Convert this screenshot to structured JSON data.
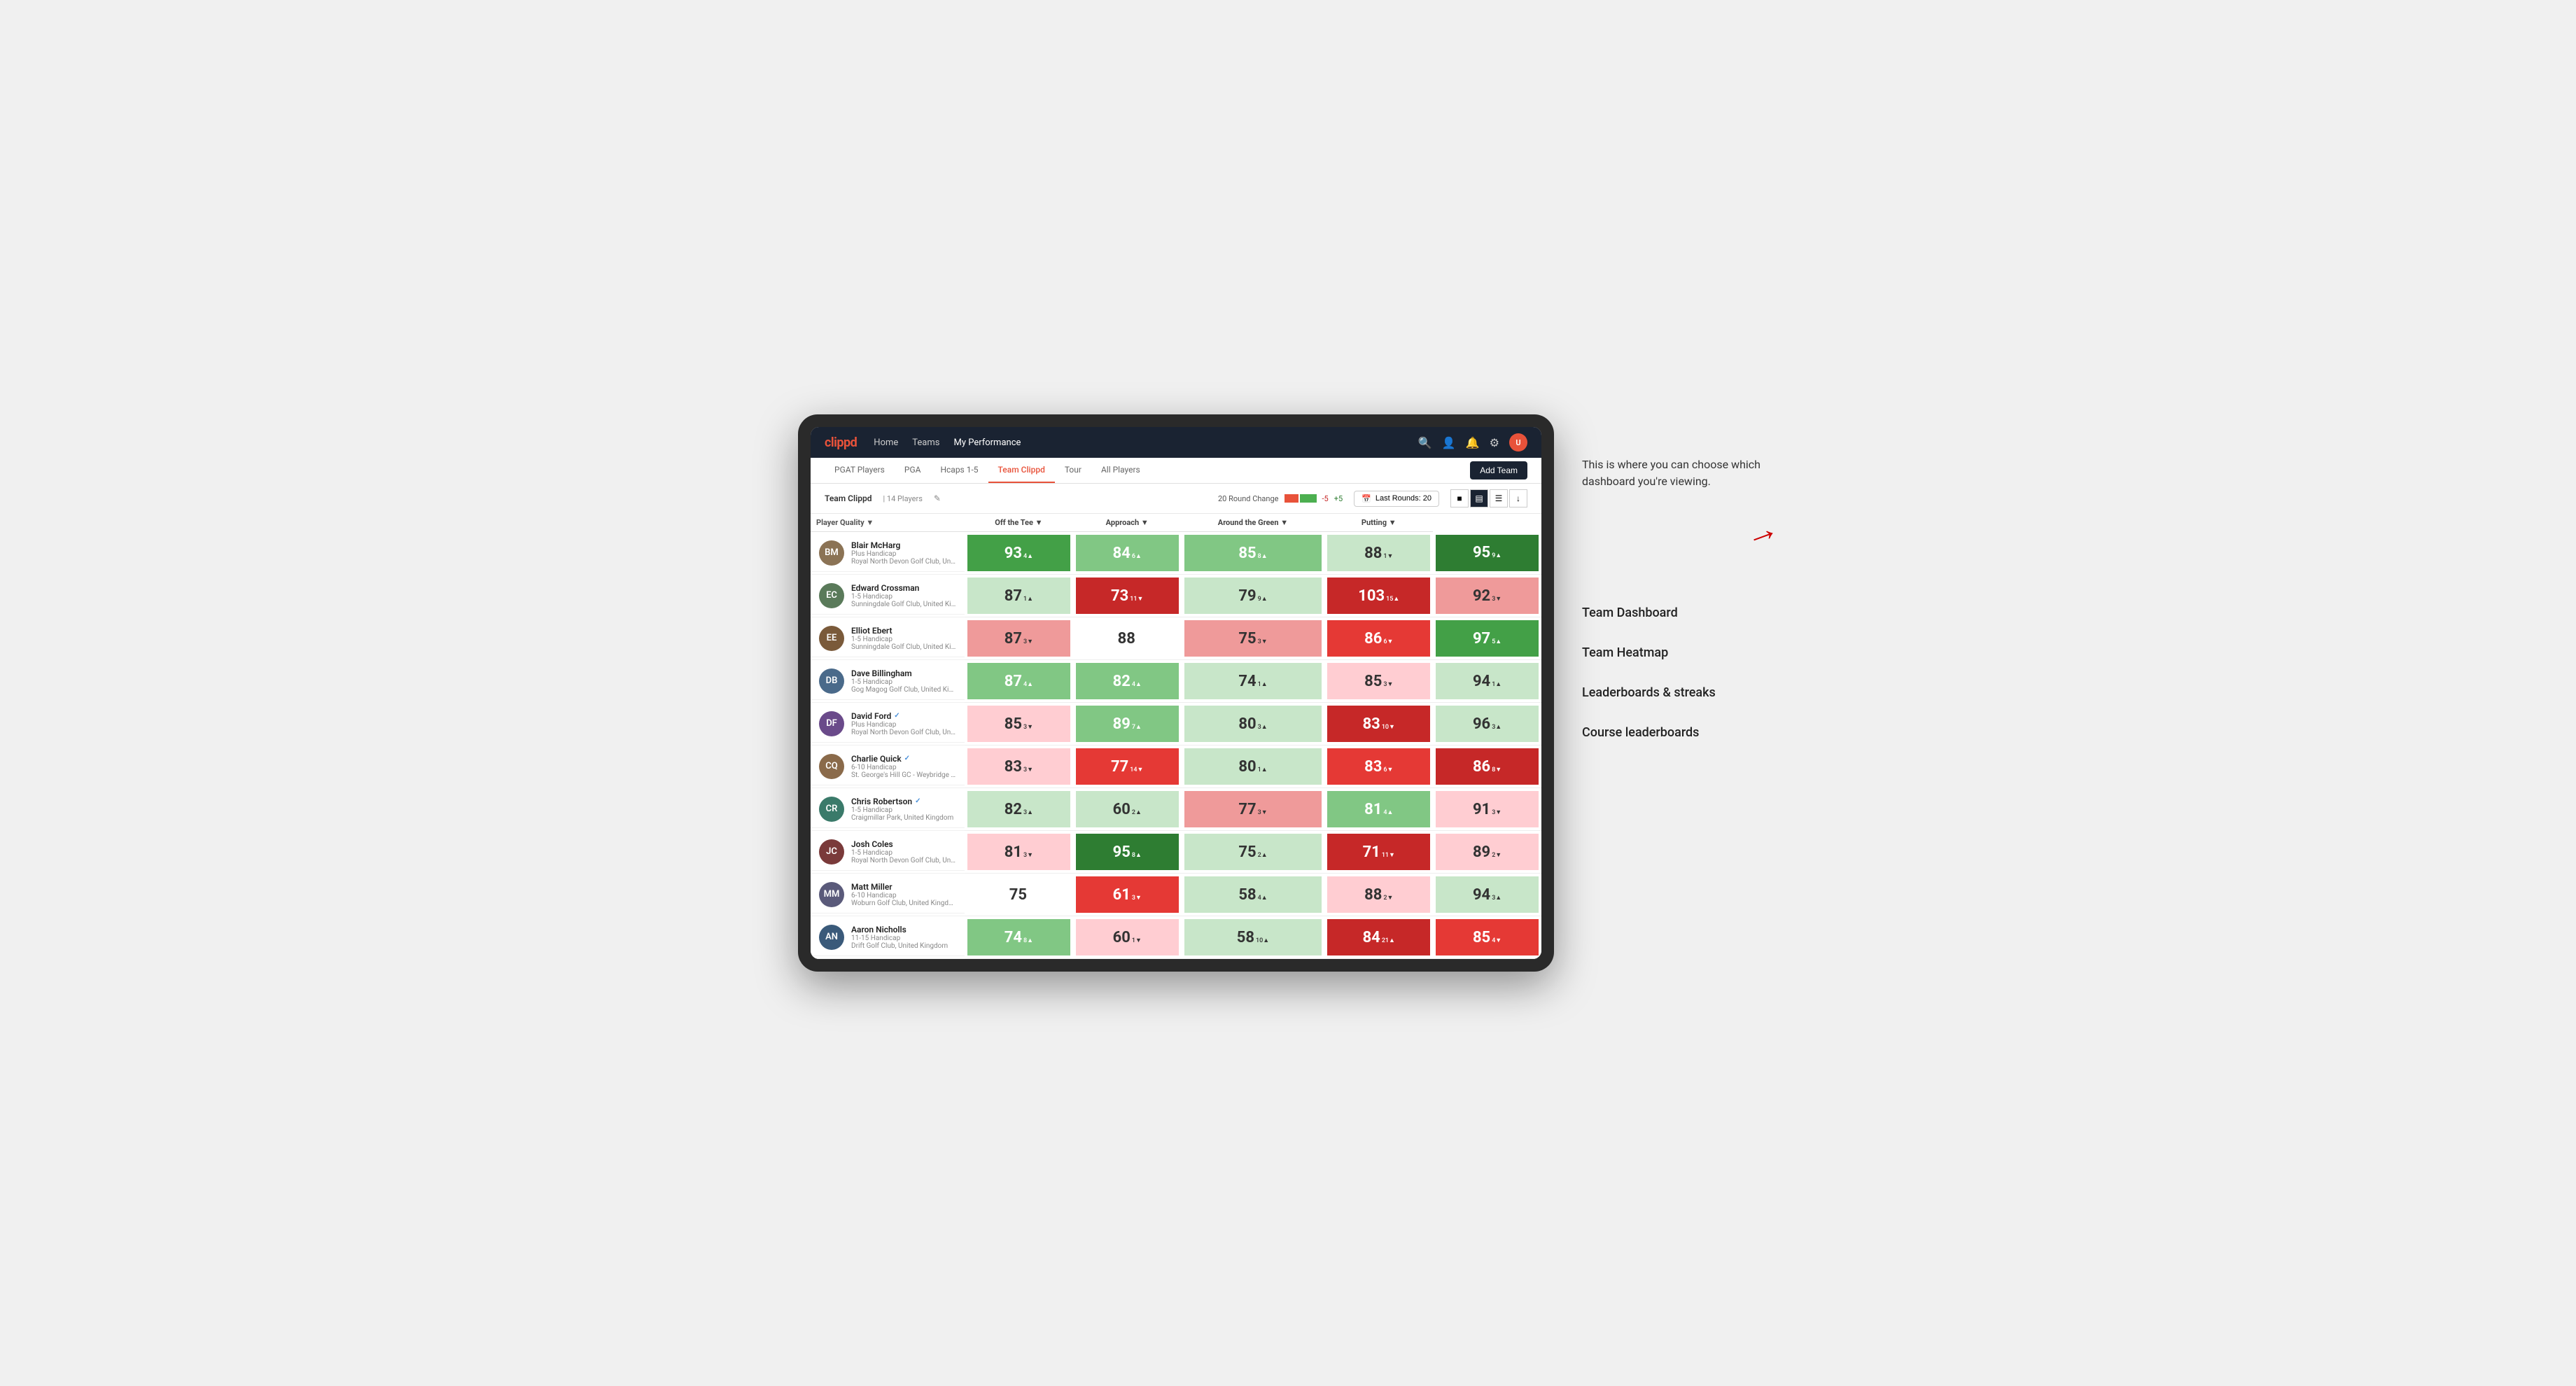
{
  "annotation": {
    "intro_text": "This is where you can choose which dashboard you're viewing.",
    "menu_items": [
      "Team Dashboard",
      "Team Heatmap",
      "Leaderboards & streaks",
      "Course leaderboards"
    ]
  },
  "app": {
    "logo": "clippd",
    "nav_links": [
      "Home",
      "Teams",
      "My Performance"
    ],
    "tabs": [
      "PGAT Players",
      "PGA",
      "Hcaps 1-5",
      "Team Clippd",
      "Tour",
      "All Players"
    ],
    "active_tab": "Team Clippd",
    "add_team_label": "Add Team"
  },
  "team_bar": {
    "name": "Team Clippd",
    "separator": "|",
    "count": "14 Players",
    "round_change_label": "20 Round Change",
    "change_neg": "-5",
    "change_pos": "+5",
    "last_rounds_label": "Last Rounds:",
    "last_rounds_value": "20"
  },
  "table": {
    "col_headers": {
      "player_quality": "Player Quality",
      "off_the_tee": "Off the Tee",
      "approach": "Approach",
      "around_green": "Around the Green",
      "putting": "Putting"
    },
    "players": [
      {
        "name": "Blair McHarg",
        "handicap": "Plus Handicap",
        "club": "Royal North Devon Golf Club, United Kingdom",
        "avatar_color": "#8B7355",
        "initials": "BM",
        "scores": [
          {
            "value": 93,
            "change": 4,
            "dir": "up",
            "color": "green-mid"
          },
          {
            "value": 84,
            "change": 6,
            "dir": "up",
            "color": "green-light"
          },
          {
            "value": 85,
            "change": 8,
            "dir": "up",
            "color": "green-light"
          },
          {
            "value": 88,
            "change": 1,
            "dir": "down",
            "color": "green-pale"
          },
          {
            "value": 95,
            "change": 9,
            "dir": "up",
            "color": "green-dark"
          }
        ]
      },
      {
        "name": "Edward Crossman",
        "handicap": "1-5 Handicap",
        "club": "Sunningdale Golf Club, United Kingdom",
        "avatar_color": "#5a7a5a",
        "initials": "EC",
        "scores": [
          {
            "value": 87,
            "change": 1,
            "dir": "up",
            "color": "green-pale"
          },
          {
            "value": 73,
            "change": 11,
            "dir": "down",
            "color": "red-dark"
          },
          {
            "value": 79,
            "change": 9,
            "dir": "up",
            "color": "green-pale"
          },
          {
            "value": 103,
            "change": 15,
            "dir": "up",
            "color": "red-dark"
          },
          {
            "value": 92,
            "change": 3,
            "dir": "down",
            "color": "red-light"
          }
        ]
      },
      {
        "name": "Elliot Ebert",
        "handicap": "1-5 Handicap",
        "club": "Sunningdale Golf Club, United Kingdom",
        "avatar_color": "#7a5a3a",
        "initials": "EE",
        "scores": [
          {
            "value": 87,
            "change": 3,
            "dir": "down",
            "color": "red-light"
          },
          {
            "value": 88,
            "change": 0,
            "dir": "none",
            "color": "neutral"
          },
          {
            "value": 75,
            "change": 3,
            "dir": "down",
            "color": "red-light"
          },
          {
            "value": 86,
            "change": 6,
            "dir": "down",
            "color": "red-mid"
          },
          {
            "value": 97,
            "change": 5,
            "dir": "up",
            "color": "green-mid"
          }
        ]
      },
      {
        "name": "Dave Billingham",
        "handicap": "1-5 Handicap",
        "club": "Gog Magog Golf Club, United Kingdom",
        "avatar_color": "#4a6a8a",
        "initials": "DB",
        "scores": [
          {
            "value": 87,
            "change": 4,
            "dir": "up",
            "color": "green-light"
          },
          {
            "value": 82,
            "change": 4,
            "dir": "up",
            "color": "green-light"
          },
          {
            "value": 74,
            "change": 1,
            "dir": "up",
            "color": "green-pale"
          },
          {
            "value": 85,
            "change": 3,
            "dir": "down",
            "color": "red-pale"
          },
          {
            "value": 94,
            "change": 1,
            "dir": "up",
            "color": "green-pale"
          }
        ]
      },
      {
        "name": "David Ford",
        "handicap": "Plus Handicap",
        "club": "Royal North Devon Golf Club, United Kingdom",
        "avatar_color": "#6a4a8a",
        "initials": "DF",
        "verified": true,
        "scores": [
          {
            "value": 85,
            "change": 3,
            "dir": "down",
            "color": "red-pale"
          },
          {
            "value": 89,
            "change": 7,
            "dir": "up",
            "color": "green-light"
          },
          {
            "value": 80,
            "change": 3,
            "dir": "up",
            "color": "green-pale"
          },
          {
            "value": 83,
            "change": 10,
            "dir": "down",
            "color": "red-dark"
          },
          {
            "value": 96,
            "change": 3,
            "dir": "up",
            "color": "green-pale"
          }
        ]
      },
      {
        "name": "Charlie Quick",
        "handicap": "6-10 Handicap",
        "club": "St. George's Hill GC - Weybridge - Surrey, Uni...",
        "avatar_color": "#8a6a4a",
        "initials": "CQ",
        "verified": true,
        "scores": [
          {
            "value": 83,
            "change": 3,
            "dir": "down",
            "color": "red-pale"
          },
          {
            "value": 77,
            "change": 14,
            "dir": "down",
            "color": "red-mid"
          },
          {
            "value": 80,
            "change": 1,
            "dir": "up",
            "color": "green-pale"
          },
          {
            "value": 83,
            "change": 6,
            "dir": "down",
            "color": "red-mid"
          },
          {
            "value": 86,
            "change": 8,
            "dir": "down",
            "color": "red-dark"
          }
        ]
      },
      {
        "name": "Chris Robertson",
        "handicap": "1-5 Handicap",
        "club": "Craigmillar Park, United Kingdom",
        "avatar_color": "#3a7a6a",
        "initials": "CR",
        "verified": true,
        "scores": [
          {
            "value": 82,
            "change": 3,
            "dir": "up",
            "color": "green-pale"
          },
          {
            "value": 60,
            "change": 2,
            "dir": "up",
            "color": "green-pale"
          },
          {
            "value": 77,
            "change": 3,
            "dir": "down",
            "color": "red-light"
          },
          {
            "value": 81,
            "change": 4,
            "dir": "up",
            "color": "green-light"
          },
          {
            "value": 91,
            "change": 3,
            "dir": "down",
            "color": "red-pale"
          }
        ]
      },
      {
        "name": "Josh Coles",
        "handicap": "1-5 Handicap",
        "club": "Royal North Devon Golf Club, United Kingdom",
        "avatar_color": "#7a3a3a",
        "initials": "JC",
        "scores": [
          {
            "value": 81,
            "change": 3,
            "dir": "down",
            "color": "red-pale"
          },
          {
            "value": 95,
            "change": 8,
            "dir": "up",
            "color": "green-dark"
          },
          {
            "value": 75,
            "change": 2,
            "dir": "up",
            "color": "green-pale"
          },
          {
            "value": 71,
            "change": 11,
            "dir": "down",
            "color": "red-dark"
          },
          {
            "value": 89,
            "change": 2,
            "dir": "down",
            "color": "red-pale"
          }
        ]
      },
      {
        "name": "Matt Miller",
        "handicap": "6-10 Handicap",
        "club": "Woburn Golf Club, United Kingdom",
        "avatar_color": "#5a5a7a",
        "initials": "MM",
        "scores": [
          {
            "value": 75,
            "change": 0,
            "dir": "none",
            "color": "neutral"
          },
          {
            "value": 61,
            "change": 3,
            "dir": "down",
            "color": "red-mid"
          },
          {
            "value": 58,
            "change": 4,
            "dir": "up",
            "color": "green-pale"
          },
          {
            "value": 88,
            "change": 2,
            "dir": "down",
            "color": "red-pale"
          },
          {
            "value": 94,
            "change": 3,
            "dir": "up",
            "color": "green-pale"
          }
        ]
      },
      {
        "name": "Aaron Nicholls",
        "handicap": "11-15 Handicap",
        "club": "Drift Golf Club, United Kingdom",
        "avatar_color": "#3a5a7a",
        "initials": "AN",
        "scores": [
          {
            "value": 74,
            "change": 8,
            "dir": "up",
            "color": "green-light"
          },
          {
            "value": 60,
            "change": 1,
            "dir": "down",
            "color": "red-pale"
          },
          {
            "value": 58,
            "change": 10,
            "dir": "up",
            "color": "green-pale"
          },
          {
            "value": 84,
            "change": 21,
            "dir": "up",
            "color": "red-dark"
          },
          {
            "value": 85,
            "change": 4,
            "dir": "down",
            "color": "red-mid"
          }
        ]
      }
    ]
  }
}
